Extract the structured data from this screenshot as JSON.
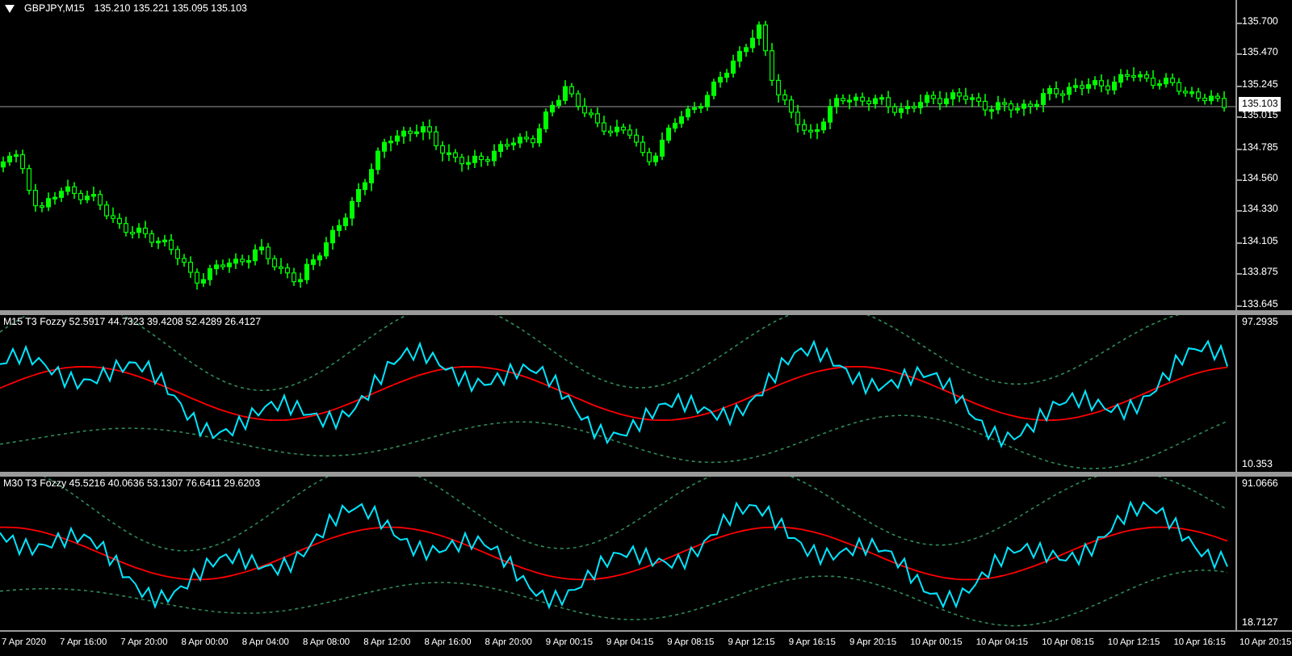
{
  "symbol": {
    "title": "GBPJPY,M15",
    "ohlc": "135.210 135.221 135.095 135.103"
  },
  "price_axis": {
    "ticks": [
      "135.700",
      "135.470",
      "135.245",
      "135.015",
      "134.785",
      "134.560",
      "134.330",
      "134.105",
      "133.875",
      "133.645"
    ],
    "current_price": "135.103"
  },
  "indicators": [
    {
      "label": "M15 T3 Fozzy 52.5917 44.7323 39.4208 52.4289 26.4127",
      "axis_max": "97.2935",
      "axis_min": "10.353"
    },
    {
      "label": "M30 T3 Fozzy 45.5216 40.0636 53.1307 76.6411 29.6203",
      "axis_max": "91.0666",
      "axis_min": "18.7127"
    }
  ],
  "time_axis": [
    "7 Apr 2020",
    "7 Apr 16:00",
    "7 Apr 20:00",
    "8 Apr 00:00",
    "8 Apr 04:00",
    "8 Apr 08:00",
    "8 Apr 12:00",
    "8 Apr 16:00",
    "8 Apr 20:00",
    "9 Apr 00:15",
    "9 Apr 04:15",
    "9 Apr 08:15",
    "9 Apr 12:15",
    "9 Apr 16:15",
    "9 Apr 20:15",
    "10 Apr 00:15",
    "10 Apr 04:15",
    "10 Apr 08:15",
    "10 Apr 12:15",
    "10 Apr 16:15",
    "10 Apr 20:15"
  ]
}
